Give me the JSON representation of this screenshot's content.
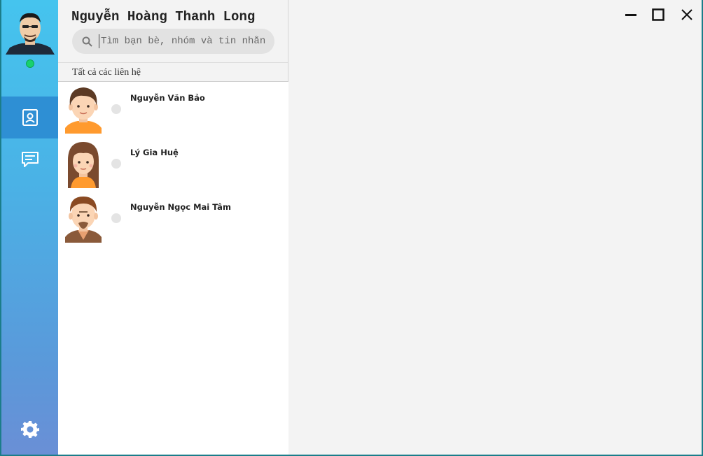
{
  "user": {
    "name": "Nguyễn Hoàng Thanh Long",
    "status_color": "#18d16e"
  },
  "search": {
    "placeholder": "Tìm bạn bè, nhóm và tin nhắn"
  },
  "section": {
    "label": "Tất cả các liên hệ"
  },
  "nav": {
    "items": [
      {
        "icon": "contact-card-icon",
        "active": true
      },
      {
        "icon": "chat-message-icon",
        "active": false
      },
      {
        "icon": "gear-icon",
        "active": false
      }
    ]
  },
  "contacts": [
    {
      "name": "Nguyễn Văn Bảo",
      "avatar": "boy-avatar-orange-shirt-icon",
      "status": "offline"
    },
    {
      "name": "Lý Gia Huệ",
      "avatar": "girl-avatar-long-hair-icon",
      "status": "offline"
    },
    {
      "name": "Nguyễn Ngọc Mai Tâm",
      "avatar": "man-avatar-beard-icon",
      "status": "offline"
    }
  ],
  "window_controls": [
    "minimize-icon",
    "maximize-icon",
    "close-icon"
  ],
  "colors": {
    "rail_top": "#45c4ee",
    "rail_bottom": "#6a8fd6",
    "rail_active": "#2e8fd4",
    "online": "#18d16e"
  }
}
